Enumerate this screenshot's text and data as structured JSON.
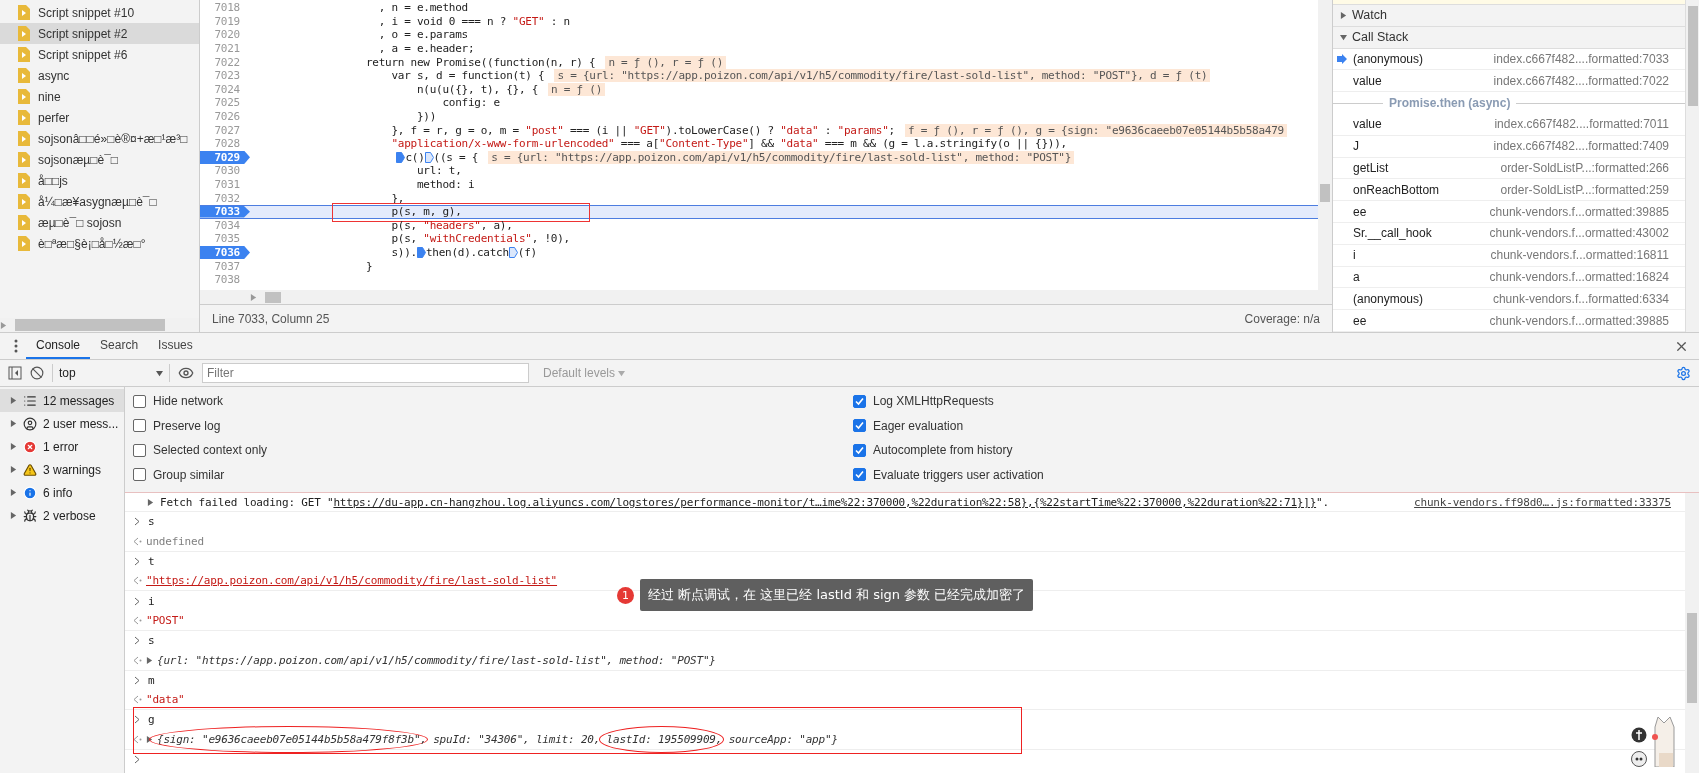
{
  "navigator": {
    "items": [
      {
        "label": "Script snippet #10",
        "selected": false
      },
      {
        "label": "Script snippet #2",
        "selected": true
      },
      {
        "label": "Script snippet #6",
        "selected": false
      },
      {
        "label": "async",
        "selected": false
      },
      {
        "label": "nine",
        "selected": false
      },
      {
        "label": "perfer",
        "selected": false
      },
      {
        "label": "sojsonâ□□é»□è®¤+æ□¹æ³□",
        "selected": false
      },
      {
        "label": "sojsonæµ□è¯□",
        "selected": false
      },
      {
        "label": "å□□js",
        "selected": false
      },
      {
        "label": "å¼□æ¥asygnæµ□è¯□",
        "selected": false
      },
      {
        "label": "æµ□è¯□ sojosn",
        "selected": false
      },
      {
        "label": "è□ªæ□§è¡□å□½æ□°",
        "selected": false
      }
    ]
  },
  "editor": {
    "lines": [
      {
        "number": "7018",
        "breakpoint": false,
        "current": false,
        "code": [
          {
            "kind": "text",
            "text": "                  , n = e.method"
          }
        ]
      },
      {
        "number": "7019",
        "breakpoint": false,
        "current": false,
        "code": [
          {
            "kind": "text",
            "text": "                  , i = void 0 === n ? \"GET\" : n"
          }
        ]
      },
      {
        "number": "7020",
        "breakpoint": false,
        "current": false,
        "code": [
          {
            "kind": "text",
            "text": "                  , o = e.params"
          }
        ]
      },
      {
        "number": "7021",
        "breakpoint": false,
        "current": false,
        "code": [
          {
            "kind": "text",
            "text": "                  , a = e.header;"
          }
        ]
      },
      {
        "number": "7022",
        "breakpoint": false,
        "current": false,
        "code": [
          {
            "kind": "text",
            "text": "                return new Promise((function(n, r) {"
          }
        ],
        "annotation": "n = ƒ (), r = ƒ ()"
      },
      {
        "number": "7023",
        "breakpoint": false,
        "current": false,
        "code": [
          {
            "kind": "text",
            "text": "                    var s, d = function(t) {"
          }
        ],
        "annotation": "s = {url: \"https://app.poizon.com/api/v1/h5/commodity/fire/last-sold-list\", method: \"POST\"}, d = ƒ (t)"
      },
      {
        "number": "7024",
        "breakpoint": false,
        "current": false,
        "code": [
          {
            "kind": "text",
            "text": "                        n(u(u({}, t), {}, {"
          }
        ],
        "annotation": "n = ƒ ()"
      },
      {
        "number": "7025",
        "breakpoint": false,
        "current": false,
        "code": [
          {
            "kind": "text",
            "text": "                            config: e"
          }
        ]
      },
      {
        "number": "7026",
        "breakpoint": false,
        "current": false,
        "code": [
          {
            "kind": "text",
            "text": "                        }))"
          }
        ]
      },
      {
        "number": "7027",
        "breakpoint": false,
        "current": false,
        "code": [
          {
            "kind": "text",
            "text": "                    }, f = r, g = o, m = \"post\" === (i || \"GET\").toLowerCase() ? \"data\" : \"params\";"
          }
        ],
        "annotation": "f = ƒ (), r = ƒ (), g = {sign: \"e9636caeeb07e05144b5b58a479"
      },
      {
        "number": "7028",
        "breakpoint": false,
        "current": false,
        "code": [
          {
            "kind": "text",
            "text": "                    \"application/x-www-form-urlencoded\" === a[\"Content-Type\"] && \"data\" === m && (g = l.a.stringify(o || {})),"
          }
        ]
      },
      {
        "number": "7029",
        "breakpoint": true,
        "current": false,
        "code": [
          {
            "kind": "marker",
            "on": true
          },
          {
            "kind": "text",
            "text": "c()"
          },
          {
            "kind": "marker",
            "on": false
          },
          {
            "kind": "text",
            "text": "((s = {"
          }
        ],
        "annotation": "s = {url: \"https://app.poizon.com/api/v1/h5/commodity/fire/last-sold-list\", method: \"POST\"}"
      },
      {
        "number": "7030",
        "breakpoint": false,
        "current": false,
        "code": [
          {
            "kind": "text",
            "text": "                        url: t,"
          }
        ]
      },
      {
        "number": "7031",
        "breakpoint": false,
        "current": false,
        "code": [
          {
            "kind": "text",
            "text": "                        method: i"
          }
        ]
      },
      {
        "number": "7032",
        "breakpoint": false,
        "current": false,
        "code": [
          {
            "kind": "text",
            "text": "                    },"
          }
        ]
      },
      {
        "number": "7033",
        "breakpoint": true,
        "current": true,
        "boxed": true,
        "code": [
          {
            "kind": "text",
            "text": "                    p(s, m, g),"
          }
        ]
      },
      {
        "number": "7034",
        "breakpoint": false,
        "current": false,
        "code": [
          {
            "kind": "text",
            "text": "                    p(s, \"headers\", a),"
          }
        ]
      },
      {
        "number": "7035",
        "breakpoint": false,
        "current": false,
        "code": [
          {
            "kind": "text",
            "text": "                    p(s, \"withCredentials\", !0),"
          }
        ]
      },
      {
        "number": "7036",
        "breakpoint": true,
        "current": false,
        "code": [
          {
            "kind": "text",
            "text": "                    s))."
          },
          {
            "kind": "marker",
            "on": true
          },
          {
            "kind": "text",
            "text": "then(d).catch"
          },
          {
            "kind": "marker",
            "on": false
          },
          {
            "kind": "text",
            "text": "(f)"
          }
        ]
      },
      {
        "number": "7037",
        "breakpoint": false,
        "current": false,
        "code": [
          {
            "kind": "text",
            "text": "                }"
          }
        ]
      },
      {
        "number": "7038",
        "breakpoint": false,
        "current": false
      }
    ],
    "status": {
      "position": "Line 7033, Column 25",
      "coverage": "Coverage: n/a"
    }
  },
  "debugger": {
    "sections": [
      {
        "title": "Watch",
        "expanded": false
      },
      {
        "title": "Call Stack",
        "expanded": true
      }
    ],
    "frames": [
      {
        "kind": "frame",
        "name": "(anonymous)",
        "location": "index.c667f482....formatted:7033",
        "current": true
      },
      {
        "kind": "frame",
        "name": "value",
        "location": "index.c667f482....formatted:7022",
        "current": false
      },
      {
        "kind": "separator",
        "name": "Promise.then (async)"
      },
      {
        "kind": "frame",
        "name": "value",
        "location": "index.c667f482....formatted:7011",
        "current": false
      },
      {
        "kind": "frame",
        "name": "J",
        "location": "index.c667f482....formatted:7409",
        "current": false
      },
      {
        "kind": "frame",
        "name": "getList",
        "location": "order-SoldListP...:formatted:266",
        "current": false
      },
      {
        "kind": "frame",
        "name": "onReachBottom",
        "location": "order-SoldListP...:formatted:259",
        "current": false
      },
      {
        "kind": "frame",
        "name": "ee",
        "location": "chunk-vendors.f...ormatted:39885",
        "current": false
      },
      {
        "kind": "frame",
        "name": "Sr.__call_hook",
        "location": "chunk-vendors.f...ormatted:43002",
        "current": false
      },
      {
        "kind": "frame",
        "name": "i",
        "location": "chunk-vendors.f...ormatted:16811",
        "current": false
      },
      {
        "kind": "frame",
        "name": "a",
        "location": "chunk-vendors.f...ormatted:16824",
        "current": false
      },
      {
        "kind": "frame",
        "name": "(anonymous)",
        "location": "chunk-vendors.f...formatted:6334",
        "current": false
      },
      {
        "kind": "frame",
        "name": "ee",
        "location": "chunk-vendors.f...ormatted:39885",
        "current": false
      }
    ]
  },
  "drawer": {
    "tabs": [
      {
        "label": "Console",
        "selected": true
      },
      {
        "label": "Search",
        "selected": false
      },
      {
        "label": "Issues",
        "selected": false
      }
    ],
    "toolbar": {
      "context": "top",
      "filter_placeholder": "Filter",
      "levels": "Default levels"
    },
    "groups": [
      {
        "kind": "messages",
        "label": "12 messages",
        "selected": true
      },
      {
        "kind": "user",
        "label": "2 user mess...",
        "selected": false
      },
      {
        "kind": "error",
        "label": "1 error",
        "selected": false
      },
      {
        "kind": "warning",
        "label": "3 warnings",
        "selected": false
      },
      {
        "kind": "info",
        "label": "6 info",
        "selected": false
      },
      {
        "kind": "verbose",
        "label": "2 verbose",
        "selected": false
      }
    ],
    "settings_left": [
      {
        "label": "Hide network",
        "checked": false
      },
      {
        "label": "Preserve log",
        "checked": false
      },
      {
        "label": "Selected context only",
        "checked": false
      },
      {
        "label": "Group similar",
        "checked": false
      }
    ],
    "settings_right": [
      {
        "label": "Log XMLHttpRequests",
        "checked": true
      },
      {
        "label": "Eager evaluation",
        "checked": true
      },
      {
        "label": "Autocomplete from history",
        "checked": true
      },
      {
        "label": "Evaluate triggers user activation",
        "checked": true
      }
    ],
    "network_message": {
      "text": "Fetch failed loading: GET \"",
      "link": "https://du-app.cn-hangzhou.log.aliyuncs.com/logstores/performance-monitor/t…ime%22:370000,%22duration%22:58},{%22startTime%22:370000,%22duration%22:71}]}",
      "suffix": "\".",
      "source": "chunk-vendors.ff98d0….js:formatted:33375"
    },
    "entries": [
      {
        "command": "s",
        "result": {
          "kind": "undefined",
          "segments": [
            {
              "text": "undefined"
            }
          ]
        }
      },
      {
        "command": "t",
        "result": {
          "kind": "link",
          "segments": [
            {
              "text": "\"https://app.poizon.com/api/v1/h5/commodity/fire/last-sold-list\""
            }
          ]
        }
      },
      {
        "command": "i",
        "result": {
          "kind": "string",
          "segments": [
            {
              "text": "\"POST\""
            }
          ]
        }
      },
      {
        "command": "s",
        "result": {
          "kind": "object",
          "segments": [
            {
              "text": "{url: \"https://app.poizon.com/api/v1/h5/commodity/fire/last-sold-list\", method: \"POST\"}"
            }
          ]
        }
      },
      {
        "command": "m",
        "result": {
          "kind": "string",
          "segments": [
            {
              "text": "\"data\""
            }
          ]
        }
      },
      {
        "command": "g",
        "boxed": true,
        "result": {
          "kind": "object",
          "segments": [
            {
              "text": "{sign: \"e9636caeeb07e05144b5b58a479f8f3b\"",
              "circled": true
            },
            {
              "text": ", spuId: \"34306\", limit: 20, ",
              "circled": false
            },
            {
              "text": "lastId: 195509909",
              "circled": true
            },
            {
              "text": ", sourceApp: \"app\"}",
              "circled": false
            }
          ]
        }
      }
    ],
    "callout": {
      "badge": "1",
      "text": "经过 断点调试，在 这里已经  lastId 和 sign 参数 已经完成加密了"
    }
  }
}
